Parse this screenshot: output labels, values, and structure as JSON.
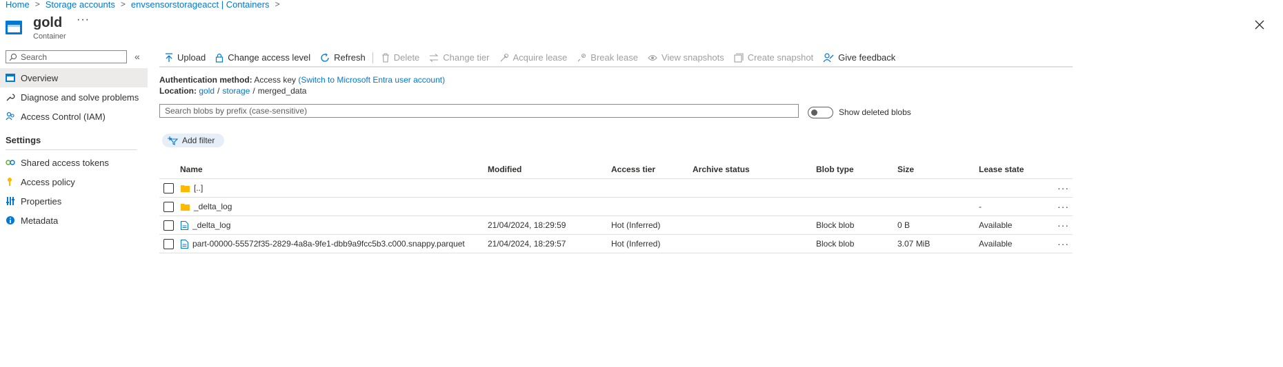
{
  "breadcrumb": [
    "Home",
    "Storage accounts",
    "envsensorstorageacct | Containers"
  ],
  "header": {
    "title": "gold",
    "subtitle": "Container",
    "more": "···"
  },
  "sidebar": {
    "search_placeholder": "Search",
    "items": [
      {
        "label": "Overview",
        "icon": "container-icon",
        "active": true
      },
      {
        "label": "Diagnose and solve problems",
        "icon": "wrench-icon"
      },
      {
        "label": "Access Control (IAM)",
        "icon": "people-icon"
      }
    ],
    "settings_heading": "Settings",
    "settings_items": [
      {
        "label": "Shared access tokens",
        "icon": "link-icon"
      },
      {
        "label": "Access policy",
        "icon": "key-icon"
      },
      {
        "label": "Properties",
        "icon": "sliders-icon"
      },
      {
        "label": "Metadata",
        "icon": "info-icon"
      }
    ]
  },
  "toolbar": {
    "upload": "Upload",
    "change_access": "Change access level",
    "refresh": "Refresh",
    "delete": "Delete",
    "change_tier": "Change tier",
    "acquire_lease": "Acquire lease",
    "break_lease": "Break lease",
    "view_snapshots": "View snapshots",
    "create_snapshot": "Create snapshot",
    "give_feedback": "Give feedback"
  },
  "info": {
    "auth_label": "Authentication method:",
    "auth_value": "Access key",
    "auth_switch": "(Switch to Microsoft Entra user account)",
    "location_label": "Location:",
    "location_path": [
      "gold",
      "storage"
    ],
    "location_current": "merged_data",
    "path_separator": "/"
  },
  "blob_search": {
    "placeholder": "Search blobs by prefix (case-sensitive)"
  },
  "show_deleted": {
    "label": "Show deleted blobs",
    "on": false
  },
  "add_filter": "Add filter",
  "table": {
    "columns": [
      "Name",
      "Modified",
      "Access tier",
      "Archive status",
      "Blob type",
      "Size",
      "Lease state"
    ],
    "rows": [
      {
        "name": "[..]",
        "kind": "folder",
        "modified": "",
        "tier": "",
        "archive": "",
        "blob_type": "",
        "size": "",
        "lease": ""
      },
      {
        "name": "_delta_log",
        "kind": "folder",
        "modified": "",
        "tier": "",
        "archive": "",
        "blob_type": "",
        "size": "",
        "lease": "-"
      },
      {
        "name": "_delta_log",
        "kind": "file",
        "modified": "21/04/2024, 18:29:59",
        "tier": "Hot (Inferred)",
        "archive": "",
        "blob_type": "Block blob",
        "size": "0 B",
        "lease": "Available"
      },
      {
        "name": "part-00000-55572f35-2829-4a8a-9fe1-dbb9a9fcc5b3.c000.snappy.parquet",
        "kind": "file",
        "modified": "21/04/2024, 18:29:57",
        "tier": "Hot (Inferred)",
        "archive": "",
        "blob_type": "Block blob",
        "size": "3.07 MiB",
        "lease": "Available"
      }
    ],
    "row_more": "···"
  },
  "colors": {
    "accent": "#0078d4",
    "folder": "#ffb900",
    "active_bg": "#edebe9"
  }
}
